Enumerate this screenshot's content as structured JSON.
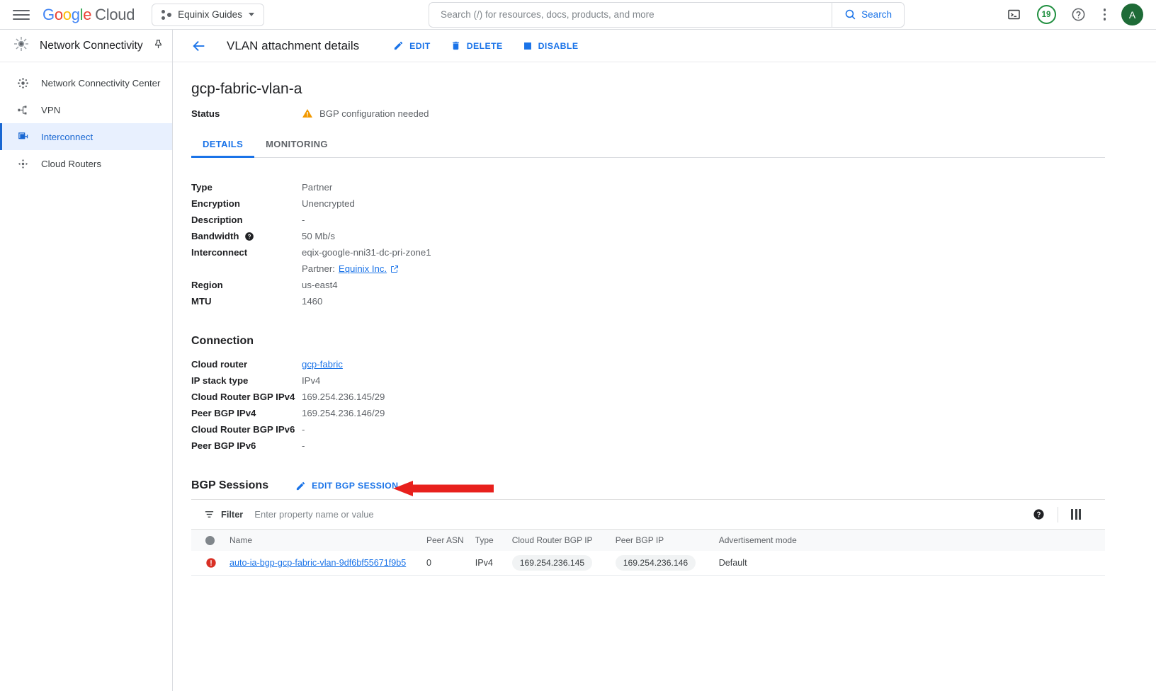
{
  "topbar": {
    "menu_icon": "hamburger-icon",
    "logo": {
      "google": "Google",
      "cloud": "Cloud"
    },
    "project": {
      "label": "Equinix Guides"
    },
    "search": {
      "placeholder": "Search (/) for resources, docs, products, and more",
      "value": "",
      "button_label": "Search"
    },
    "notifications_count": "19",
    "avatar_initial": "A",
    "cloud_shell_icon": "terminal-icon",
    "help_icon": "help-circle-icon",
    "more_icon": "kebab-menu-icon"
  },
  "sidebar": {
    "title": "Network Connectivity",
    "pin_icon": "pin-icon",
    "items": [
      {
        "label": "Network Connectivity Center",
        "icon": "hub-icon",
        "active": false
      },
      {
        "label": "VPN",
        "icon": "vpn-icon",
        "active": false
      },
      {
        "label": "Interconnect",
        "icon": "interconnect-icon",
        "active": true
      },
      {
        "label": "Cloud Routers",
        "icon": "router-icon",
        "active": false
      }
    ]
  },
  "page": {
    "back_icon": "back-arrow-icon",
    "title": "VLAN attachment details",
    "actions": [
      {
        "label": "EDIT",
        "icon": "pencil-icon"
      },
      {
        "label": "DELETE",
        "icon": "trash-icon"
      },
      {
        "label": "DISABLE",
        "icon": "square-icon"
      }
    ],
    "resource_name": "gcp-fabric-vlan-a",
    "status": {
      "key": "Status",
      "value": "BGP configuration needed",
      "icon": "warning-triangle-icon",
      "color": "#f29900"
    },
    "tabs": [
      {
        "label": "DETAILS",
        "active": true
      },
      {
        "label": "MONITORING",
        "active": false
      }
    ],
    "details": [
      {
        "key": "Type",
        "value": "Partner"
      },
      {
        "key": "Encryption",
        "value": "Unencrypted"
      },
      {
        "key": "Description",
        "value": "-"
      },
      {
        "key": "Bandwidth",
        "value": "50 Mb/s",
        "help_icon": "help-circle-icon"
      },
      {
        "key": "Interconnect",
        "value": "eqix-google-nni31-dc-pri-zone1",
        "sub_prefix": "Partner:",
        "sub_link": "Equinix Inc.",
        "sub_link_icon": "external-link-icon"
      },
      {
        "key": "Region",
        "value": "us-east4"
      },
      {
        "key": "MTU",
        "value": "1460"
      }
    ],
    "connection": {
      "title": "Connection",
      "rows": [
        {
          "key": "Cloud router",
          "value": "gcp-fabric",
          "is_link": true
        },
        {
          "key": "IP stack type",
          "value": "IPv4"
        },
        {
          "key": "Cloud Router BGP IPv4",
          "value": "169.254.236.145/29"
        },
        {
          "key": "Peer BGP IPv4",
          "value": "169.254.236.146/29"
        },
        {
          "key": "Cloud Router BGP IPv6",
          "value": "-"
        },
        {
          "key": "Peer BGP IPv6",
          "value": "-"
        }
      ]
    },
    "bgp_sessions": {
      "title": "BGP Sessions",
      "edit_action": {
        "label": "EDIT BGP SESSION",
        "icon": "pencil-icon"
      },
      "annotation": {
        "type": "red-arrow",
        "color": "#e8201c",
        "points_to": "EDIT BGP SESSION"
      },
      "toolbar": {
        "filter_label": "Filter",
        "filter_icon": "filter-icon",
        "filter_placeholder": "Enter property name or value",
        "filter_value": "",
        "help_icon": "help-circle-icon",
        "columns_icon": "column-settings-icon"
      },
      "columns": [
        "",
        "Name",
        "Peer ASN",
        "Type",
        "Cloud Router BGP IP",
        "Peer BGP IP",
        "Advertisement mode"
      ],
      "rows": [
        {
          "status_icon": "error-circle-icon",
          "status_color": "#d93025",
          "name": "auto-ia-bgp-gcp-fabric-vlan-9df6bf55671f9b5",
          "peer_asn": "0",
          "type": "IPv4",
          "cloud_router_bgp_ip": "169.254.236.145",
          "peer_bgp_ip": "169.254.236.146",
          "advertisement_mode": "Default"
        }
      ]
    }
  }
}
